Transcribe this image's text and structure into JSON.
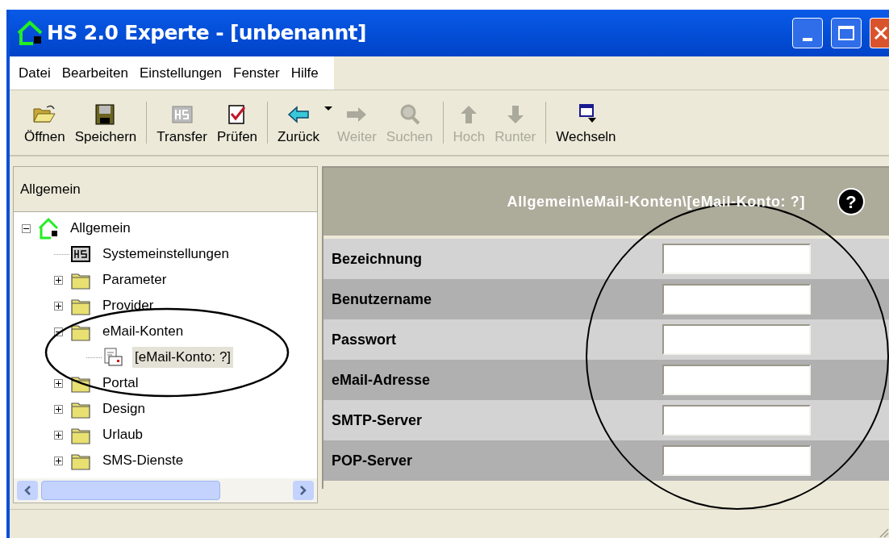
{
  "window": {
    "title": "HS 2.0 Experte - [unbenannt]"
  },
  "menu": [
    "Datei",
    "Bearbeiten",
    "Einstellungen",
    "Fenster",
    "Hilfe"
  ],
  "toolbar": [
    {
      "kind": "open",
      "label": "Öffnen",
      "disabled": false
    },
    {
      "kind": "save",
      "label": "Speichern",
      "disabled": false
    },
    {
      "kind": "separator"
    },
    {
      "kind": "hs",
      "label": "Transfer",
      "disabled": false
    },
    {
      "kind": "check",
      "label": "Prüfen",
      "disabled": false
    },
    {
      "kind": "separator"
    },
    {
      "kind": "back",
      "label": "Zurück",
      "disabled": false,
      "dropdown": true
    },
    {
      "kind": "forward",
      "label": "Weiter",
      "disabled": true
    },
    {
      "kind": "search",
      "label": "Suchen",
      "disabled": true
    },
    {
      "kind": "separator"
    },
    {
      "kind": "up",
      "label": "Hoch",
      "disabled": true
    },
    {
      "kind": "down",
      "label": "Runter",
      "disabled": true
    },
    {
      "kind": "separator"
    },
    {
      "kind": "switch",
      "label": "Wechseln",
      "disabled": false
    }
  ],
  "tree_panel": {
    "title": "Allgemein",
    "items": [
      {
        "kind": "home",
        "label": "Allgemein",
        "expanded": true,
        "selected": false,
        "children": [
          {
            "kind": "hs",
            "label": "Systemeinstellungen",
            "selected": false
          },
          {
            "kind": "folder",
            "label": "Parameter",
            "expanded": false,
            "selected": false
          },
          {
            "kind": "folder",
            "label": "Provider",
            "expanded": false,
            "selected": false
          },
          {
            "kind": "folder",
            "label": "eMail-Konten",
            "expanded": true,
            "selected": false,
            "children": [
              {
                "kind": "mail",
                "label": "[eMail-Konto: ?]",
                "selected": true
              }
            ]
          },
          {
            "kind": "folder",
            "label": "Portal",
            "expanded": false,
            "selected": false
          },
          {
            "kind": "folder",
            "label": "Design",
            "expanded": false,
            "selected": false
          },
          {
            "kind": "folder",
            "label": "Urlaub",
            "expanded": false,
            "selected": false
          },
          {
            "kind": "folder",
            "label": "SMS-Dienste",
            "expanded": false,
            "selected": false
          }
        ]
      }
    ]
  },
  "form": {
    "path": "Allgemein\\eMail-Konten\\[eMail-Konto: ?]",
    "help": "?",
    "fields": [
      {
        "label": "Bezeichnung"
      },
      {
        "label": "Benutzername"
      },
      {
        "label": "Passwort"
      },
      {
        "label": "eMail-Adresse"
      },
      {
        "label": "SMTP-Server"
      },
      {
        "label": "POP-Server"
      }
    ]
  }
}
